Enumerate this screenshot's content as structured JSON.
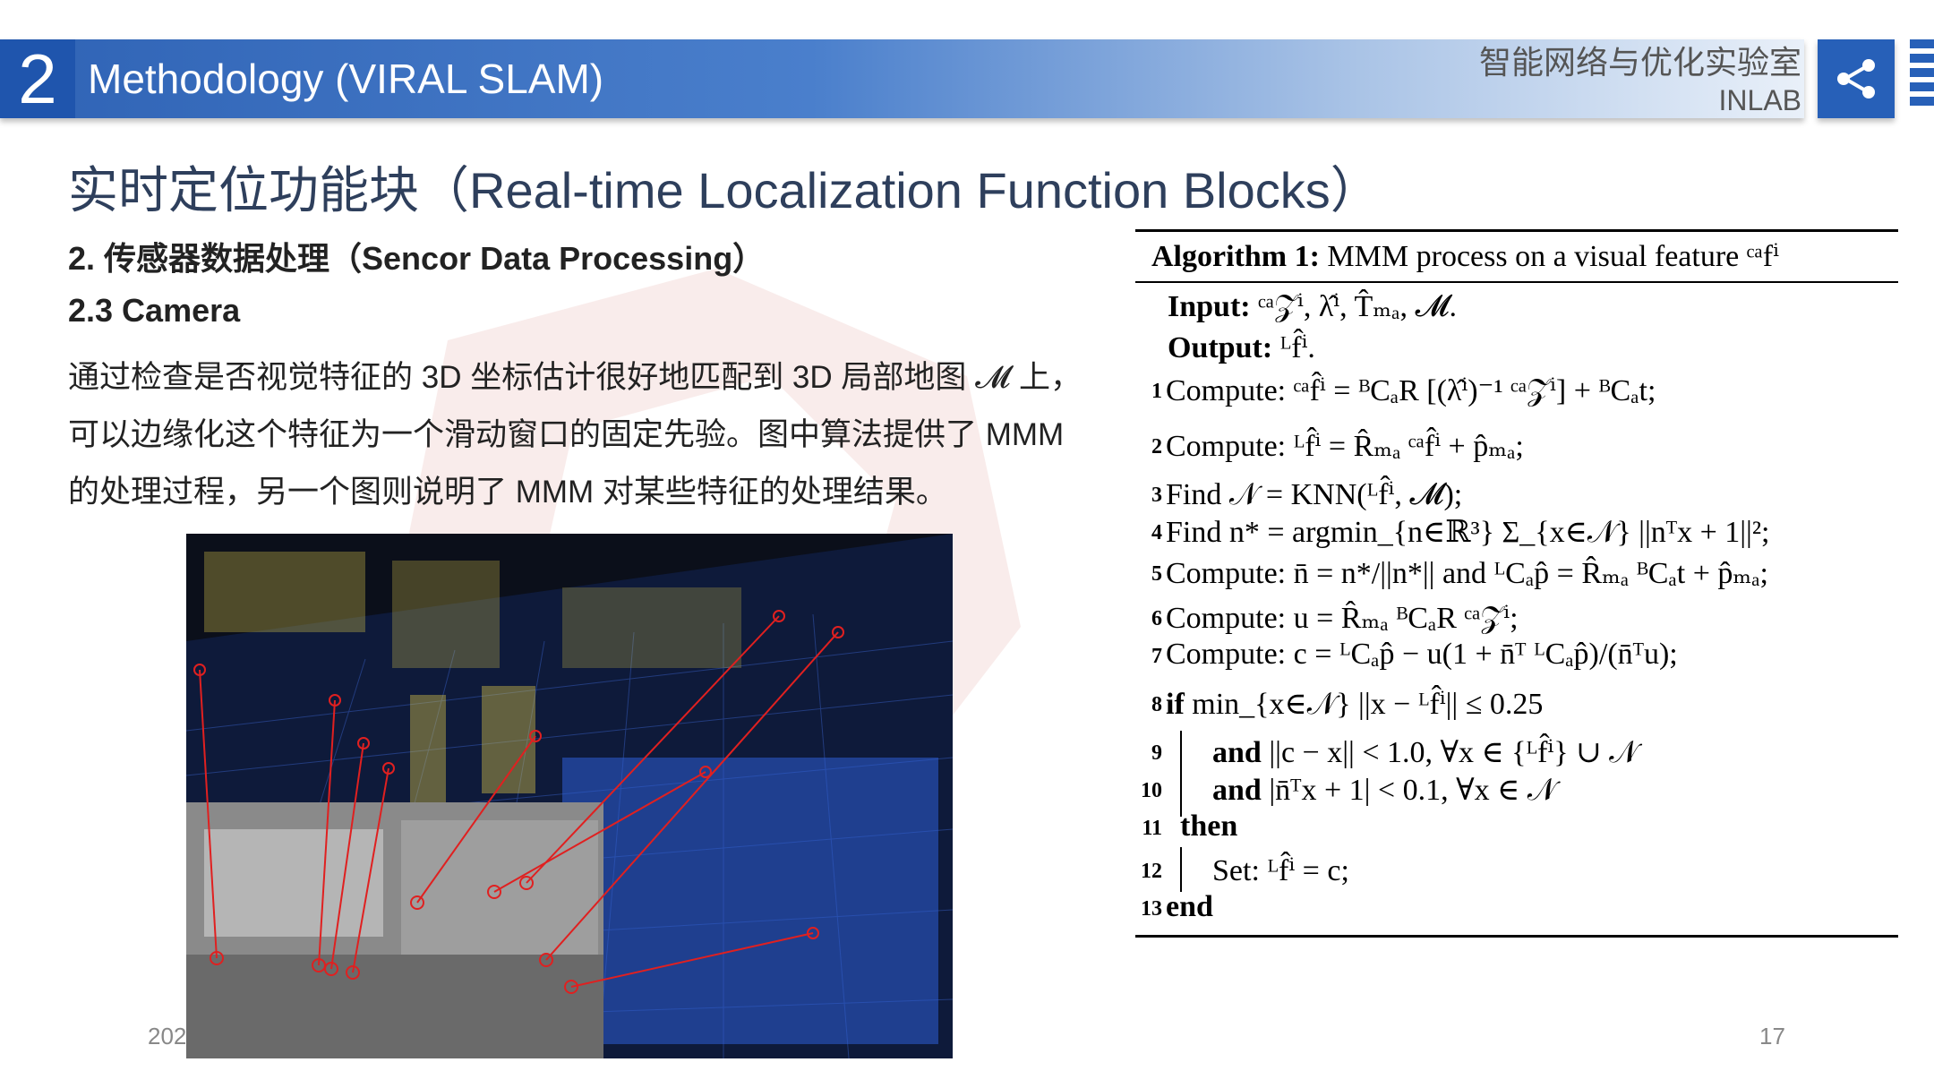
{
  "header": {
    "section_number": "2",
    "title": "Methodology (VIRAL SLAM)",
    "lab_name": "智能网络与优化实验室",
    "lab_sub": "INLAB",
    "share_icon": "share-icon",
    "brand_color": "#2760b8"
  },
  "main": {
    "heading": "实时定位功能块（Real-time Localization Function Blocks）",
    "subheading1": "2. 传感器数据处理（Sencor Data Processing）",
    "subheading2": "2.3 Camera",
    "paragraph_lines": [
      "通过检查是否视觉特征的 3D 坐标估计很好地匹配到 3D 局部地图 𝓜 上，",
      "可以边缘化这个特征为一个滑动窗口的固定先验。图中算法提供了 MMM",
      "的处理过程，另一个图则说明了 MMM 对某些特征的处理结果。"
    ]
  },
  "algorithm": {
    "caption_label": "Algorithm 1:",
    "caption_text": " MMM process on a visual feature ᶜᵃfⁱ",
    "input_label": "Input:",
    "input_text": " ᶜᵃ𝒵ⁱ, λ̂ⁱ, T̂ₘₐ, 𝓜.",
    "output_label": "Output:",
    "output_text": " ᴸf̂ⁱ.",
    "lines": [
      {
        "num": "1",
        "kw": "Compute:",
        "text": " ᶜᵃf̂ⁱ = ᴮCₐR [(λ̂ⁱ)⁻¹ ᶜᵃ𝒵ⁱ] + ᴮCₐt;"
      },
      {
        "num": "2",
        "kw": "Compute:",
        "text": " ᴸf̂ⁱ = R̂ₘₐ ᶜᵃf̂ⁱ + p̂ₘₐ;"
      },
      {
        "num": "3",
        "kw": "Find",
        "text": " 𝒩 = KNN(ᴸf̂ⁱ, 𝓜);"
      },
      {
        "num": "4",
        "kw": "Find",
        "text": " n* = argmin_{n∈ℝ³} Σ_{x∈𝒩} ||nᵀx + 1||²;"
      },
      {
        "num": "5",
        "kw": "Compute:",
        "text": " n̄ = n*/||n*|| and ᴸCₐp̂ = R̂ₘₐ ᴮCₐt + p̂ₘₐ;"
      },
      {
        "num": "6",
        "kw": "Compute:",
        "text": " u = R̂ₘₐ ᴮCₐR ᶜᵃ𝒵ⁱ;"
      },
      {
        "num": "7",
        "kw": "Compute:",
        "text": " c = ᴸCₐp̂ − u(1 + n̄ᵀ ᴸCₐp̂)/(n̄ᵀu);"
      },
      {
        "num": "8",
        "kw": "if",
        "text": " min_{x∈𝒩} ||x − ᴸf̂ⁱ|| ≤ 0.25"
      },
      {
        "num": "9",
        "kw": "and",
        "text": " ||c − x|| < 1.0,  ∀x ∈ {ᴸf̂ⁱ} ∪ 𝒩"
      },
      {
        "num": "10",
        "kw": "and",
        "text": " |n̄ᵀx + 1| < 0.1,  ∀x ∈ 𝒩"
      },
      {
        "num": "11",
        "kw": "then",
        "text": ""
      },
      {
        "num": "12",
        "kw": "",
        "text": "Set: ᴸf̂ⁱ = c;"
      },
      {
        "num": "13",
        "kw": "end",
        "text": ""
      }
    ]
  },
  "footer": {
    "year_fragment": "202",
    "page_number": "17"
  }
}
